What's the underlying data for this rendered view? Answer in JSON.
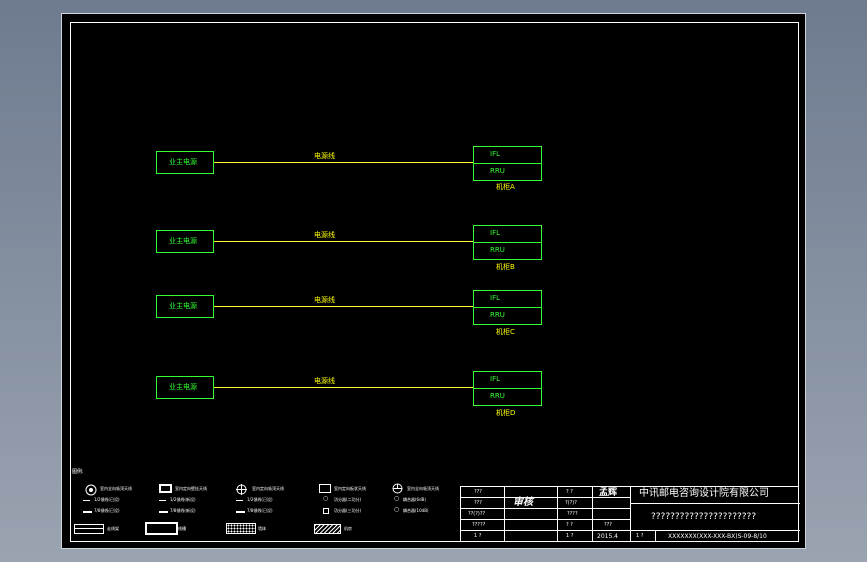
{
  "diagram": {
    "rows": [
      {
        "source_label": "业主电源",
        "cable_label": "电源线",
        "rack_top": "IFL",
        "rack_bottom": "RRU",
        "rack_caption": "机柜A"
      },
      {
        "source_label": "业主电源",
        "cable_label": "电源线",
        "rack_top": "IFL",
        "rack_bottom": "RRU",
        "rack_caption": "机柜B"
      },
      {
        "source_label": "业主电源",
        "cable_label": "电源线",
        "rack_top": "IFL",
        "rack_bottom": "RRU",
        "rack_caption": "机柜C"
      },
      {
        "source_label": "业主电源",
        "cable_label": "电源线",
        "rack_top": "IFL",
        "rack_bottom": "RRU",
        "rack_caption": "机柜D"
      }
    ]
  },
  "legend": {
    "title": "图例:",
    "row1": [
      "室内全向吸顶天线",
      "室内定向壁挂天线",
      "室内定向吸顶天线",
      "室内定向板状天线",
      "室内全向吸顶天线"
    ],
    "row2": [
      "1/2馈线(已设)",
      "1/2馈线(新设)",
      "1/2馈线(已设)",
      "功分器(二功分)",
      "耦合器(6dB)"
    ],
    "row3": [
      "7/8馈线(已设)",
      "7/8馈线(新设)",
      "7/8馈线(已设)",
      "功分器(三功分)",
      "耦合器(10dB)"
    ],
    "row4": [
      "走线架",
      "线槽",
      "墙体",
      "机房"
    ]
  },
  "title_block": {
    "left_labels": [
      "???",
      "???",
      "??(?)??",
      "?????",
      "1  ?"
    ],
    "signature": "审核",
    "mid_labels": [
      "?  ?",
      "?(?)?",
      "????",
      "?  ?",
      "1  ?"
    ],
    "mid_values": [
      "",
      "",
      "",
      "???",
      "2015.4"
    ],
    "stamp": "孟辉",
    "company": "中讯邮电咨询设计院有限公司",
    "drawing_title": "??????????????????????",
    "sheet_no": "1  ?",
    "drawing_no": "XXXXXXX(XXX-XXX-BX)S-09-8/10"
  }
}
